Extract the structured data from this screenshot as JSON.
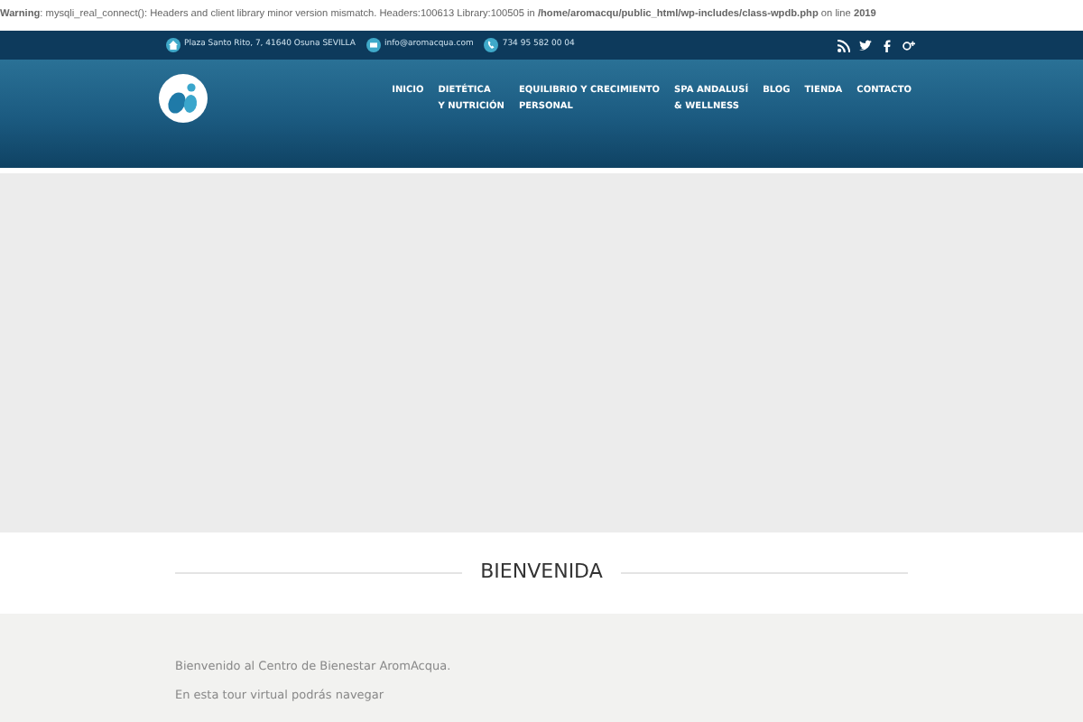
{
  "warning": "**Warning**: mysqli_real_connect(): Headers and client library minor version mismatch. Headers:100613 Library:100505 in **/home/aromacqu/public_html/wp-includes/class-wpdb.php** on line **2019**",
  "topbar": {
    "contacts": [
      {
        "kind": "address",
        "text": "Plaza Santo Rito, 7, 41640 Osuna SEVILLA"
      },
      {
        "kind": "email",
        "text": "info@aromacqua.com"
      },
      {
        "kind": "phone",
        "text": "734 95 582 00 04"
      }
    ],
    "social": [
      {
        "kind": "rss"
      },
      {
        "kind": "twitter"
      },
      {
        "kind": "facebook"
      },
      {
        "kind": "googleplus"
      }
    ]
  },
  "nav": [
    {
      "lines": [
        "INICIO"
      ]
    },
    {
      "lines": [
        "DIETÉTICA",
        "Y NUTRICIÓN"
      ]
    },
    {
      "lines": [
        "EQUILIBRIO Y CRECIMIENTO",
        "PERSONAL"
      ]
    },
    {
      "lines": [
        "SPA ANDALUSÍ",
        "& WELLNESS"
      ]
    },
    {
      "lines": [
        "BLOG"
      ]
    },
    {
      "lines": [
        "TIENDA"
      ]
    },
    {
      "lines": [
        "CONTACTO"
      ]
    }
  ],
  "section_title": "BIENVENIDA",
  "paragraphs": [
    "Bienvenido al Centro de Bienestar AromAcqua.",
    "En esta tour virtual podrás navegar"
  ]
}
